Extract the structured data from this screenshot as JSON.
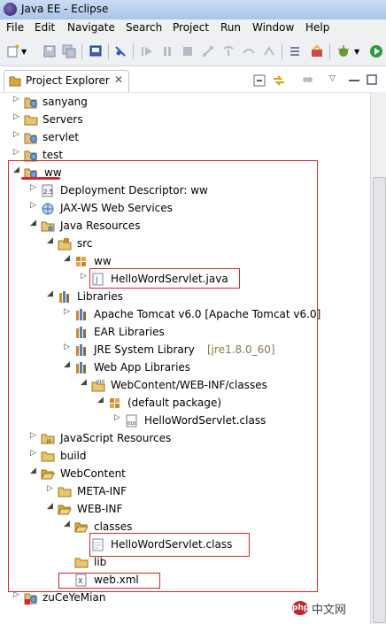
{
  "window": {
    "title": "Java EE - Eclipse"
  },
  "menu": [
    "File",
    "Edit",
    "Navigate",
    "Search",
    "Project",
    "Run",
    "Window",
    "Help"
  ],
  "view": {
    "tab_label": "Project Explorer",
    "close_glyph": "✕"
  },
  "tree": [
    {
      "label": "sanyang"
    },
    {
      "label": "Servers"
    },
    {
      "label": "servlet"
    },
    {
      "label": "test"
    },
    {
      "label": "ww"
    },
    {
      "label": "Deployment Descriptor: ww"
    },
    {
      "label": "JAX-WS Web Services"
    },
    {
      "label": "Java Resources"
    },
    {
      "label": "src"
    },
    {
      "label": "ww"
    },
    {
      "label": "HelloWordServlet.java"
    },
    {
      "label": "Libraries"
    },
    {
      "label": "Apache Tomcat v6.0 [Apache Tomcat v6.0]"
    },
    {
      "label": "EAR Libraries"
    },
    {
      "label": "JRE System Library",
      "decor": "[jre1.8.0_60]"
    },
    {
      "label": "Web App Libraries"
    },
    {
      "label": "WebContent/WEB-INF/classes"
    },
    {
      "label": "(default package)"
    },
    {
      "label": "HelloWordServlet.class"
    },
    {
      "label": "JavaScript Resources"
    },
    {
      "label": "build"
    },
    {
      "label": "WebContent"
    },
    {
      "label": "META-INF"
    },
    {
      "label": "WEB-INF"
    },
    {
      "label": "classes"
    },
    {
      "label": "HelloWordServlet.class"
    },
    {
      "label": "lib"
    },
    {
      "label": "web.xml"
    },
    {
      "label": "zuCeYeMian"
    }
  ],
  "watermark": {
    "text": "中文网",
    "logo": "php"
  }
}
